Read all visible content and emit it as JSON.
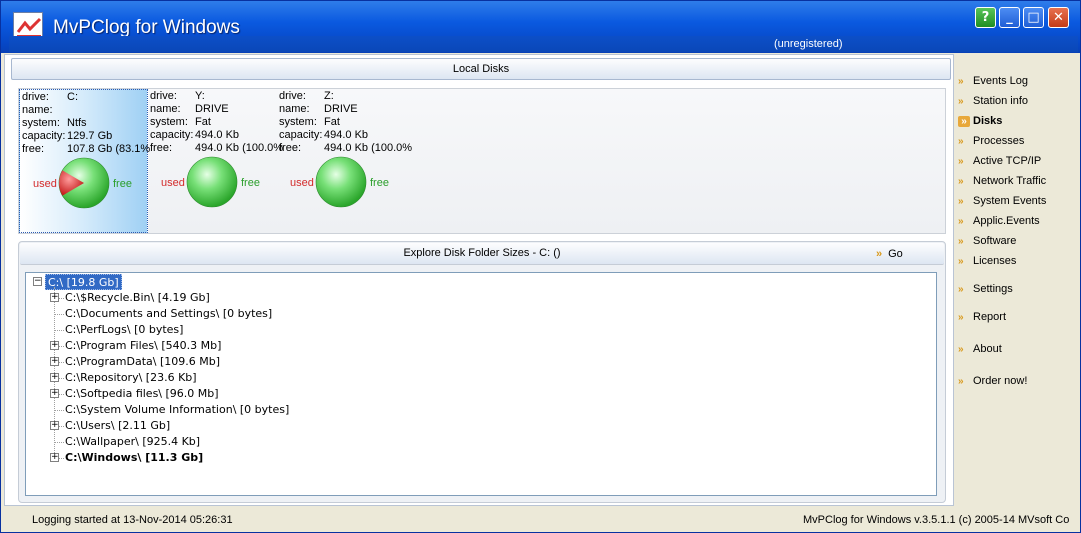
{
  "window": {
    "title": "MvPClog for Windows",
    "subtitle": "(unregistered)",
    "controls": [
      "?",
      "_",
      "□",
      "✕"
    ]
  },
  "local_disks": {
    "header": "Local Disks",
    "field_labels": [
      "drive:",
      "name:",
      "system:",
      "capacity:",
      "free:"
    ],
    "used_label": "used",
    "free_label": "free",
    "disks": [
      {
        "drive": "C:",
        "name": "",
        "system": "Ntfs",
        "capacity": "129.7 Gb",
        "free": "107.8 Gb (83.1%",
        "used_fraction": 0.169,
        "selected": true
      },
      {
        "drive": "Y:",
        "name": "DRIVE",
        "system": "Fat",
        "capacity": "494.0 Kb",
        "free": "494.0 Kb (100.0%",
        "used_fraction": 0.0,
        "selected": false
      },
      {
        "drive": "Z:",
        "name": "DRIVE",
        "system": "Fat",
        "capacity": "494.0 Kb",
        "free": "494.0 Kb (100.0%",
        "used_fraction": 0.0,
        "selected": false
      }
    ]
  },
  "explore": {
    "header": "Explore Disk Folder Sizes - C: ()",
    "go_label": "Go",
    "root": "C:\\ [19.8 Gb]",
    "folders": [
      {
        "label": "C:\\$Recycle.Bin\\ [4.19 Gb]",
        "expandable": true,
        "bold": false
      },
      {
        "label": "C:\\Documents and Settings\\ [0 bytes]",
        "expandable": false,
        "bold": false
      },
      {
        "label": "C:\\PerfLogs\\ [0 bytes]",
        "expandable": false,
        "bold": false
      },
      {
        "label": "C:\\Program Files\\ [540.3 Mb]",
        "expandable": true,
        "bold": false
      },
      {
        "label": "C:\\ProgramData\\ [109.6 Mb]",
        "expandable": true,
        "bold": false
      },
      {
        "label": "C:\\Repository\\ [23.6 Kb]",
        "expandable": true,
        "bold": false
      },
      {
        "label": "C:\\Softpedia files\\ [96.0 Mb]",
        "expandable": true,
        "bold": false
      },
      {
        "label": "C:\\System Volume Information\\ [0 bytes]",
        "expandable": false,
        "bold": false
      },
      {
        "label": "C:\\Users\\ [2.11 Gb]",
        "expandable": true,
        "bold": false
      },
      {
        "label": "C:\\Wallpaper\\ [925.4 Kb]",
        "expandable": false,
        "bold": false
      },
      {
        "label": "C:\\Windows\\ [11.3 Gb]",
        "expandable": true,
        "bold": true
      }
    ]
  },
  "nav": {
    "items": [
      {
        "label": "Events Log",
        "active": false
      },
      {
        "label": "Station info",
        "active": false
      },
      {
        "label": "Disks",
        "active": true
      },
      {
        "label": "Processes",
        "active": false
      },
      {
        "label": "Active TCP/IP",
        "active": false
      },
      {
        "label": "Network Traffic",
        "active": false
      },
      {
        "label": "System Events",
        "active": false
      },
      {
        "label": "Applic.Events",
        "active": false
      },
      {
        "label": "Software",
        "active": false
      },
      {
        "label": "Licenses",
        "active": false
      },
      {
        "label": "Settings",
        "active": false
      },
      {
        "label": "Report",
        "active": false
      },
      {
        "label": "About",
        "active": false
      },
      {
        "label": "Order now!",
        "active": false
      }
    ]
  },
  "status": {
    "left": "Logging started at 13-Nov-2014 05:26:31",
    "right": "MvPClog for Windows v.3.5.1.1 (c) 2005-14 MVsoft Co"
  },
  "colors": {
    "titlebar": "#0b5ae0",
    "selection": "#316ac5",
    "accent_chevron": "#d99a1d",
    "used": "#d32b2b",
    "free": "#2a9e2a"
  }
}
